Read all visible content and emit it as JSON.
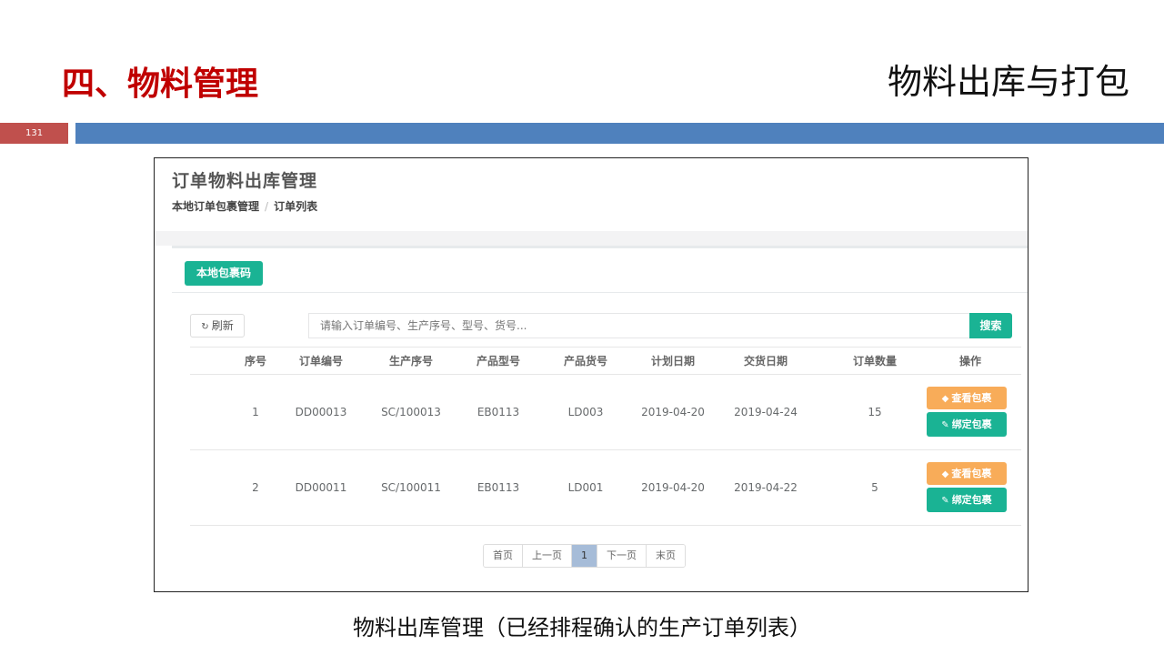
{
  "slide": {
    "section_title": "四、物料管理",
    "topic_title": "物料出库与打包",
    "page_number": "131",
    "caption": "物料出库管理（已经排程确认的生产订单列表）"
  },
  "app": {
    "title": "订单物料出库管理",
    "breadcrumb": [
      "本地订单包裹管理",
      "订单列表"
    ],
    "package_code_button": "本地包裹码",
    "refresh_button": "刷新",
    "search_placeholder": "请输入订单编号、生产序号、型号、货号...",
    "search_button": "搜索"
  },
  "table": {
    "columns": [
      "序号",
      "订单编号",
      "生产序号",
      "产品型号",
      "产品货号",
      "计划日期",
      "交货日期",
      "订单数量",
      "操作"
    ],
    "rows": [
      {
        "no": "1",
        "order_no": "DD00013",
        "prod_seq": "SC/100013",
        "model": "EB0113",
        "sku": "LD003",
        "plan_date": "2019-04-20",
        "delivery_date": "2019-04-24",
        "qty": "15"
      },
      {
        "no": "2",
        "order_no": "DD00011",
        "prod_seq": "SC/100011",
        "model": "EB0113",
        "sku": "LD001",
        "plan_date": "2019-04-20",
        "delivery_date": "2019-04-22",
        "qty": "5"
      }
    ],
    "actions": {
      "view": "查看包裹",
      "bind": "绑定包裹"
    }
  },
  "pagination": {
    "first": "首页",
    "prev": "上一页",
    "current": "1",
    "next": "下一页",
    "last": "末页"
  },
  "colors": {
    "accent_red": "#c00000",
    "bar_blue": "#4f81bd",
    "badge_red": "#c0504d",
    "green": "#1ab394",
    "orange": "#f8ac59",
    "page_active": "#a6bcd8"
  },
  "icons": {
    "refresh": "refresh-icon",
    "view": "tag-icon",
    "bind": "pencil-icon"
  }
}
